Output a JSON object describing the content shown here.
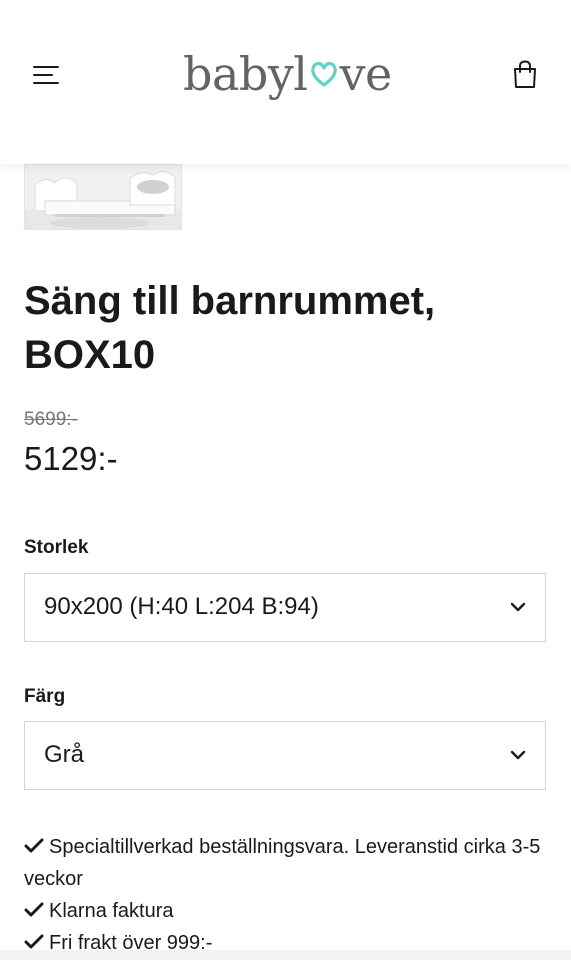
{
  "header": {
    "logo_text_left": "babyl",
    "logo_text_right": "ve",
    "menu_icon": "hamburger-menu-icon",
    "cart_icon": "shopping-bag-icon",
    "brand_color": "#5f6662",
    "heart_color": "#5fd3c4"
  },
  "product": {
    "title": "Säng till barnrummet, BOX10",
    "old_price": "5699:-",
    "price": "5129:-"
  },
  "options": {
    "size": {
      "label": "Storlek",
      "selected": "90x200 (H:40 L:204 B:94)"
    },
    "color": {
      "label": "Färg",
      "selected": "Grå"
    }
  },
  "features": [
    "Specialtillverkad beställningsvara. Leveranstid cirka 3-5 veckor",
    "Klarna faktura",
    "Fri frakt över 999:-"
  ]
}
